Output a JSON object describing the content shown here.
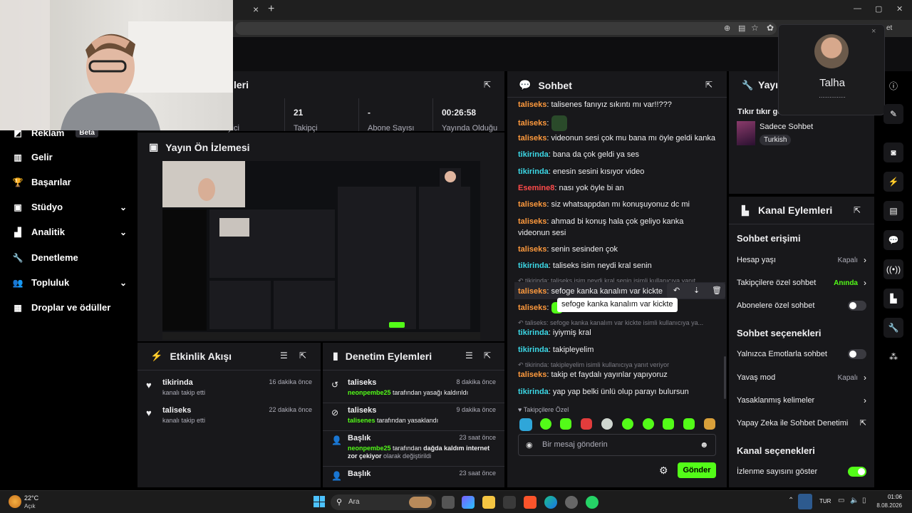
{
  "browser": {
    "close_tab": "×",
    "new_tab": "+",
    "win_min": "—",
    "win_max": "▢",
    "win_close": "✕",
    "addr_suffix": "et"
  },
  "call_popup": {
    "name": "Talha",
    "status": "...............",
    "close": "×"
  },
  "sidebar": {
    "items": [
      {
        "label": "Reklam",
        "badge": "Beta"
      },
      {
        "label": "Gelir"
      },
      {
        "label": "Başarılar"
      },
      {
        "label": "Stüdyo",
        "chevron": "⌄"
      },
      {
        "label": "Analitik",
        "chevron": "⌄"
      },
      {
        "label": "Denetleme"
      },
      {
        "label": "Topluluk",
        "chevron": "⌄"
      },
      {
        "label": "Droplar ve ödüller"
      }
    ]
  },
  "stats_panel": {
    "title_partial": "leri",
    "cells": [
      {
        "value": "",
        "label": "yici"
      },
      {
        "value": "21",
        "label": "Takipçi"
      },
      {
        "value": "-",
        "label": "Abone Sayısı"
      },
      {
        "value": "00:26:58",
        "label": "Yayında Olduğu"
      }
    ]
  },
  "preview": {
    "title": "Yayın Ön İzlemesi"
  },
  "activity": {
    "title": "Etkinlik Akışı",
    "items": [
      {
        "name": "tikirinda",
        "sub": "kanalı takip etti",
        "time": "16 dakika önce"
      },
      {
        "name": "taliseks",
        "sub": "kanalı takip etti",
        "time": "22 dakika önce"
      }
    ]
  },
  "moderation": {
    "title": "Denetim Eylemleri",
    "items": [
      {
        "name": "taliseks",
        "actor": "neonpembe25",
        "text": "tarafından yasağı kaldırıldı",
        "time": "8 dakika önce"
      },
      {
        "name": "taliseks",
        "actor": "talisenes",
        "text": "tarafından yasaklandı",
        "time": "9 dakika önce"
      },
      {
        "name": "Başlık",
        "actor": "neonpembe25",
        "text_pre": "tarafından",
        "highlight": "dağda kaldım internet zor çekiyor",
        "text": "olarak değiştirildi",
        "time": "23 saat önce"
      },
      {
        "name": "Başlık",
        "time": "23 saat önce"
      }
    ]
  },
  "chat": {
    "title": "Sohbet",
    "messages": [
      {
        "user": "taliseks",
        "color": "orange",
        "text": "talisenes fanıyız sıkıntı mı var!!???"
      },
      {
        "user": "taliseks",
        "color": "orange",
        "text": "",
        "emote": true
      },
      {
        "user": "taliseks",
        "color": "orange",
        "text": "videonun sesi çok mu bana mı öyle geldi kanka"
      },
      {
        "user": "tikirinda",
        "color": "cyan",
        "text": "bana da çok geldi ya ses"
      },
      {
        "user": "tikirinda",
        "color": "cyan",
        "text": "enesin sesini kısıyor video"
      },
      {
        "user": "Esemine8",
        "color": "red",
        "text": "nası yok öyle bi an"
      },
      {
        "user": "taliseks",
        "color": "orange",
        "text": "siz whatsappdan mı konuşuyonuz dc mi"
      },
      {
        "user": "taliseks",
        "color": "orange",
        "text": "ahmad bi konuş hala çok geliyo kanka videonun sesi"
      },
      {
        "user": "taliseks",
        "color": "orange",
        "text": "senin sesinden çok"
      },
      {
        "user": "tikirinda",
        "color": "cyan",
        "text": "taliseks isim neydi kral senin"
      }
    ],
    "reply1": "tikirinda: taliseks isim neydi kral senin isimli kullanıcıya yanıt",
    "msg_reply1": {
      "user": "taliseks",
      "text": "sefoge kanka kanalım var kickte"
    },
    "msg_emote2": {
      "user": "taliseks"
    },
    "tooltip": "sefoge kanka kanalım var kickte",
    "reply2": "taliseks: sefoge kanka kanalım var kickte isimli kullanıcıya ya...",
    "msg_after1": {
      "user": "tikirinda",
      "text": "iyiymiş kral"
    },
    "msg_after2": {
      "user": "tikirinda",
      "text": "takipleyelim"
    },
    "reply3": "tikirinda: takipleyelim isimli kullanıcıya yanıt veriyor",
    "msg_after3": {
      "user": "taliseks",
      "text": "takip et faydalı yayınlar yapıyoruz"
    },
    "msg_after4": {
      "user": "tikirinda",
      "text": "yap yap belki ünlü olup parayı bulursun"
    },
    "followers_only": "Takipçilere Özel",
    "input_placeholder": "Bir mesaj gönderin",
    "send_label": "Gönder"
  },
  "stream_info": {
    "title_partial": "Yayı",
    "subtitle": "Tıkır tıkır ge",
    "category": "Sadece Sohbet",
    "tag": "Turkish"
  },
  "channel_actions": {
    "title": "Kanal Eylemleri",
    "chat_access": "Sohbet erişimi",
    "account_age": {
      "label": "Hesap yaşı",
      "value": "Kapalı"
    },
    "followers_chat": {
      "label": "Takipçilere özel sohbet",
      "value": "Anında"
    },
    "subscribers_chat": {
      "label": "Abonelere özel sohbet"
    },
    "chat_options": "Sohbet seçenekleri",
    "emote_only": {
      "label": "Yalnızca Emotlarla sohbet"
    },
    "slow_mode": {
      "label": "Yavaş mod",
      "value": "Kapalı"
    },
    "banned_words": {
      "label": "Yasaklanmış kelimeler"
    },
    "ai_moderation": {
      "label": "Yapay Zeka ile Sohbet Denetimi"
    },
    "channel_options": "Kanal seçenekleri",
    "show_viewers": {
      "label": "İzlenme sayısını göster"
    }
  },
  "taskbar": {
    "weather_temp": "22°C",
    "weather_desc": "Açık",
    "search": "Ara",
    "lang": "TUR",
    "time": "01:06",
    "date": "8.08.2026"
  },
  "colors": {
    "accent": "#53fc18",
    "panel": "#18181b",
    "background": "#000000"
  }
}
